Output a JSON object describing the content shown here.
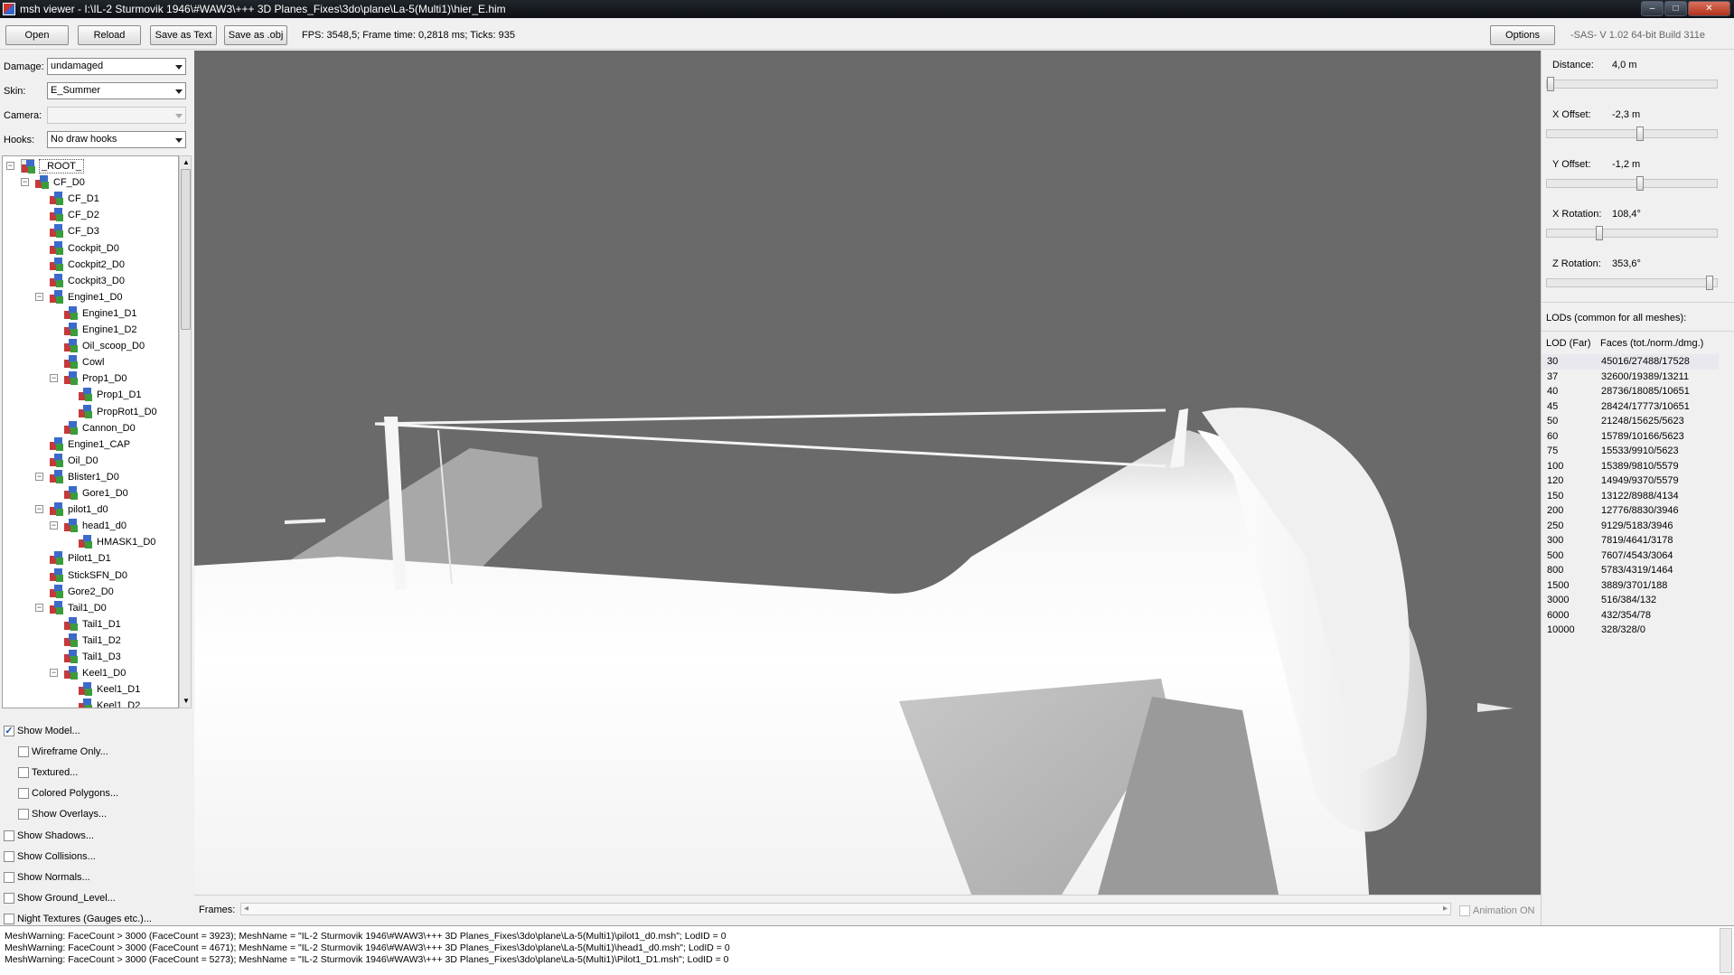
{
  "window": {
    "title": "msh viewer - I:\\IL-2 Sturmovik 1946\\#WAW3\\+++ 3D Planes_Fixes\\3do\\plane\\La-5(Multi1)\\hier_E.him",
    "minimize": "–",
    "maximize": "□",
    "close": "✕"
  },
  "toolbar": {
    "open": "Open",
    "reload": "Reload",
    "save_text": "Save as Text",
    "save_obj": "Save as .obj",
    "fps": "FPS: 3548,5; Frame time: 0,2818 ms; Ticks: 935",
    "options": "Options",
    "version": "-SAS- V 1.02  64-bit  Build 311e"
  },
  "left": {
    "damage_label": "Damage:",
    "damage_value": "undamaged",
    "skin_label": "Skin:",
    "skin_value": "E_Summer",
    "camera_label": "Camera:",
    "camera_value": "",
    "hooks_label": "Hooks:",
    "hooks_value": "No draw hooks",
    "tree": [
      {
        "label": "_ROOT_",
        "depth": 0,
        "exp": "−",
        "root": true
      },
      {
        "label": "CF_D0",
        "depth": 1,
        "exp": "−"
      },
      {
        "label": "CF_D1",
        "depth": 2,
        "exp": ""
      },
      {
        "label": "CF_D2",
        "depth": 2,
        "exp": ""
      },
      {
        "label": "CF_D3",
        "depth": 2,
        "exp": ""
      },
      {
        "label": "Cockpit_D0",
        "depth": 2,
        "exp": ""
      },
      {
        "label": "Cockpit2_D0",
        "depth": 2,
        "exp": ""
      },
      {
        "label": "Cockpit3_D0",
        "depth": 2,
        "exp": ""
      },
      {
        "label": "Engine1_D0",
        "depth": 2,
        "exp": "−"
      },
      {
        "label": "Engine1_D1",
        "depth": 3,
        "exp": ""
      },
      {
        "label": "Engine1_D2",
        "depth": 3,
        "exp": ""
      },
      {
        "label": "Oil_scoop_D0",
        "depth": 3,
        "exp": ""
      },
      {
        "label": "Cowl",
        "depth": 3,
        "exp": ""
      },
      {
        "label": "Prop1_D0",
        "depth": 3,
        "exp": "−"
      },
      {
        "label": "Prop1_D1",
        "depth": 4,
        "exp": ""
      },
      {
        "label": "PropRot1_D0",
        "depth": 4,
        "exp": ""
      },
      {
        "label": "Cannon_D0",
        "depth": 3,
        "exp": ""
      },
      {
        "label": "Engine1_CAP",
        "depth": 2,
        "exp": ""
      },
      {
        "label": "Oil_D0",
        "depth": 2,
        "exp": ""
      },
      {
        "label": "Blister1_D0",
        "depth": 2,
        "exp": "−"
      },
      {
        "label": "Gore1_D0",
        "depth": 3,
        "exp": ""
      },
      {
        "label": "pilot1_d0",
        "depth": 2,
        "exp": "−"
      },
      {
        "label": "head1_d0",
        "depth": 3,
        "exp": "−"
      },
      {
        "label": "HMASK1_D0",
        "depth": 4,
        "exp": ""
      },
      {
        "label": "Pilot1_D1",
        "depth": 2,
        "exp": ""
      },
      {
        "label": "StickSFN_D0",
        "depth": 2,
        "exp": ""
      },
      {
        "label": "Gore2_D0",
        "depth": 2,
        "exp": ""
      },
      {
        "label": "Tail1_D0",
        "depth": 2,
        "exp": "−"
      },
      {
        "label": "Tail1_D1",
        "depth": 3,
        "exp": ""
      },
      {
        "label": "Tail1_D2",
        "depth": 3,
        "exp": ""
      },
      {
        "label": "Tail1_D3",
        "depth": 3,
        "exp": ""
      },
      {
        "label": "Keel1_D0",
        "depth": 3,
        "exp": "−"
      },
      {
        "label": "Keel1_D1",
        "depth": 4,
        "exp": ""
      },
      {
        "label": "Keel1_D2",
        "depth": 4,
        "exp": ""
      }
    ],
    "options": [
      {
        "label": "Show Model...",
        "checked": true,
        "indent": false
      },
      {
        "label": "Wireframe Only...",
        "checked": false,
        "indent": true
      },
      {
        "label": "Textured...",
        "checked": false,
        "indent": true
      },
      {
        "label": "Colored Polygons...",
        "checked": false,
        "indent": true
      },
      {
        "label": "Show Overlays...",
        "checked": false,
        "indent": true
      },
      {
        "label": "Show Shadows...",
        "checked": false,
        "indent": false
      },
      {
        "label": "Show Collisions...",
        "checked": false,
        "indent": false
      },
      {
        "label": "Show Normals...",
        "checked": false,
        "indent": false
      },
      {
        "label": "Show Ground_Level...",
        "checked": false,
        "indent": false
      },
      {
        "label": "Night Textures (Gauges etc.)...",
        "checked": false,
        "indent": false
      }
    ]
  },
  "frames": {
    "label": "Frames:",
    "left_arrow": "◂",
    "right_arrow": "▸",
    "animation": "Animation ON"
  },
  "right": {
    "distance_label": "Distance:",
    "distance_value": "4,0 m",
    "distance_fraction": 0.0,
    "xoff_label": "X Offset:",
    "xoff_value": "-2,3 m",
    "xoff_fraction": 0.55,
    "yoff_label": "Y Offset:",
    "yoff_value": "-1,2 m",
    "yoff_fraction": 0.55,
    "xrot_label": "X Rotation:",
    "xrot_value": "108,4°",
    "xrot_fraction": 0.3,
    "zrot_label": "Z Rotation:",
    "zrot_value": "353,6°",
    "zrot_fraction": 0.98,
    "lod_title": "LODs (common for all meshes):",
    "lod_col1": "LOD (Far)",
    "lod_col2": "Faces (tot./norm./dmg.)",
    "lods": [
      {
        "far": "30",
        "faces": "45016/27488/17528"
      },
      {
        "far": "37",
        "faces": "32600/19389/13211"
      },
      {
        "far": "40",
        "faces": "28736/18085/10651"
      },
      {
        "far": "45",
        "faces": "28424/17773/10651"
      },
      {
        "far": "50",
        "faces": "21248/15625/5623"
      },
      {
        "far": "60",
        "faces": "15789/10166/5623"
      },
      {
        "far": "75",
        "faces": "15533/9910/5623"
      },
      {
        "far": "100",
        "faces": "15389/9810/5579"
      },
      {
        "far": "120",
        "faces": "14949/9370/5579"
      },
      {
        "far": "150",
        "faces": "13122/8988/4134"
      },
      {
        "far": "200",
        "faces": "12776/8830/3946"
      },
      {
        "far": "250",
        "faces": "9129/5183/3946"
      },
      {
        "far": "300",
        "faces": "7819/4641/3178"
      },
      {
        "far": "500",
        "faces": "7607/4543/3064"
      },
      {
        "far": "800",
        "faces": "5783/4319/1464"
      },
      {
        "far": "1500",
        "faces": "3889/3701/188"
      },
      {
        "far": "3000",
        "faces": "516/384/132"
      },
      {
        "far": "6000",
        "faces": "432/354/78"
      },
      {
        "far": "10000",
        "faces": "328/328/0"
      }
    ]
  },
  "console": [
    "MeshWarning: FaceCount > 3000 (FaceCount = 3923); MeshName = \"IL-2 Sturmovik 1946\\#WAW3\\+++ 3D Planes_Fixes\\3do\\plane\\La-5(Multi1)\\pilot1_d0.msh\"; LodID = 0",
    "MeshWarning: FaceCount > 3000 (FaceCount = 4671); MeshName = \"IL-2 Sturmovik 1946\\#WAW3\\+++ 3D Planes_Fixes\\3do\\plane\\La-5(Multi1)\\head1_d0.msh\"; LodID = 0",
    "MeshWarning: FaceCount > 3000 (FaceCount = 5273); MeshName = \"IL-2 Sturmovik 1946\\#WAW3\\+++ 3D Planes_Fixes\\3do\\plane\\La-5(Multi1)\\Pilot1_D1.msh\"; LodID = 0"
  ],
  "colors": {
    "viewport_bg": "#6a6a6a",
    "lod_selected": "#e8e8ee"
  }
}
